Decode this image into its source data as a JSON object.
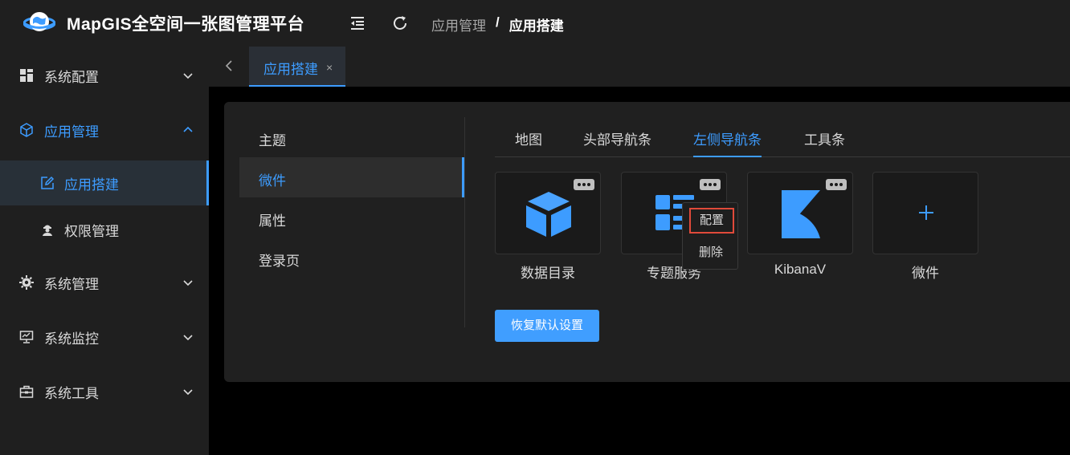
{
  "header": {
    "title": "MapGIS全空间一张图管理平台",
    "breadcrumb": [
      "应用管理",
      "/",
      "应用搭建"
    ],
    "icons": [
      "globe-logo",
      "menu-fold-icon",
      "refresh-icon"
    ]
  },
  "sidebar": {
    "items": [
      {
        "label": "系统配置",
        "icon": "grid-icon"
      },
      {
        "label": "应用管理",
        "icon": "cube-icon"
      },
      {
        "label": "应用搭建",
        "icon": "edit-icon"
      },
      {
        "label": "权限管理",
        "icon": "user-secret-icon"
      },
      {
        "label": "系统管理",
        "icon": "gear-icon"
      },
      {
        "label": "系统监控",
        "icon": "monitor-icon"
      },
      {
        "label": "系统工具",
        "icon": "toolbox-icon"
      }
    ]
  },
  "tabs": {
    "items": [
      {
        "label": "应用搭建",
        "close": "×"
      }
    ]
  },
  "leftnav": {
    "items": [
      "主题",
      "微件",
      "属性",
      "登录页"
    ]
  },
  "content_tabs": [
    "地图",
    "头部导航条",
    "左侧导航条",
    "工具条"
  ],
  "cards": [
    {
      "label": "数据目录",
      "icon": "cube-icon"
    },
    {
      "label": "专题服务",
      "icon": "list-icon"
    },
    {
      "label": "KibanaV",
      "icon": "kibana-icon"
    },
    {
      "label": "微件",
      "icon": "plus-icon"
    }
  ],
  "popup": {
    "items": [
      "配置",
      "删除"
    ]
  },
  "reset_button": "恢复默认设置",
  "colors": {
    "accent": "#3d9cff",
    "button": "#409eff",
    "highlight": "#e04a3a"
  }
}
